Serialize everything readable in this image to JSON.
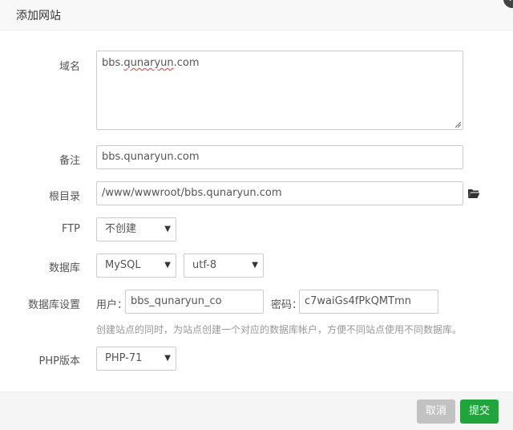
{
  "dialog": {
    "title": "添加网站"
  },
  "form": {
    "domain": {
      "label": "域名",
      "value_main": "bbs.",
      "value_underlined": "qunaryun",
      "value_rest": ".com"
    },
    "remark": {
      "label": "备注",
      "value": "bbs.qunaryun.com"
    },
    "root": {
      "label": "根目录",
      "value": "/www/wwwroot/bbs.qunaryun.com",
      "icon": "folder-open-icon"
    },
    "ftp": {
      "label": "FTP",
      "selected": "不创建"
    },
    "database": {
      "label": "数据库",
      "type_selected": "MySQL",
      "charset_selected": "utf-8"
    },
    "db_settings": {
      "label": "数据库设置",
      "user_label": "用户：",
      "user_value": "bbs_qunaryun_co",
      "password_label": "密码：",
      "password_value": "c7waiGs4fPkQMTmn",
      "hint": "创建站点的同时，为站点创建一个对应的数据库帐户，方便不同站点使用不同数据库。"
    },
    "php": {
      "label": "PHP版本",
      "selected": "PHP-71"
    }
  },
  "footer": {
    "cancel_label": "取消",
    "submit_label": "提交"
  },
  "colors": {
    "primary": "#20a53a",
    "cancel": "#c2c2c2"
  }
}
